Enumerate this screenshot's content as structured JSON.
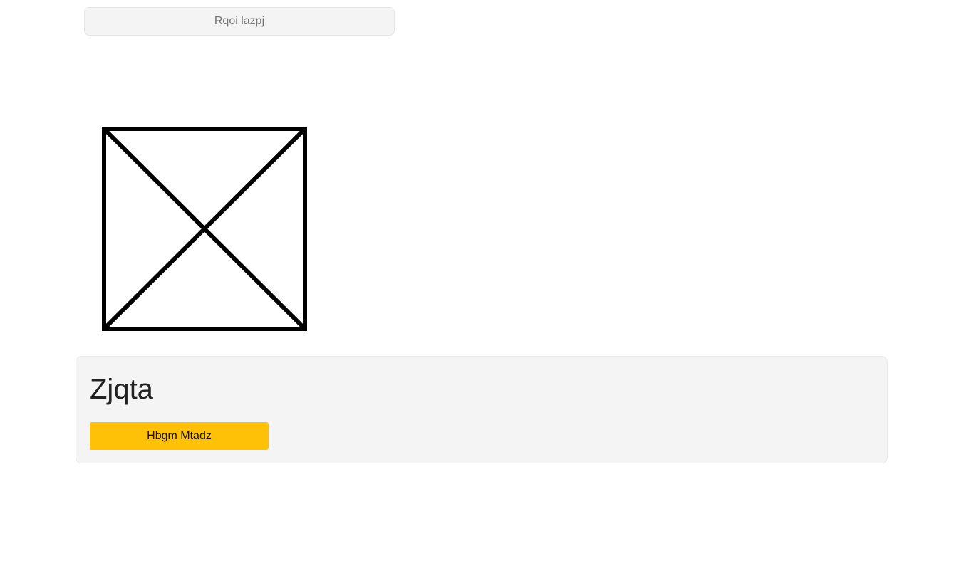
{
  "top_field": {
    "placeholder": "Rqoi lazpj"
  },
  "image": {
    "icon": "image-placeholder-icon",
    "stroke_color": "#000000"
  },
  "card": {
    "title": "Zjqta",
    "button_label": "Hbgm Mtadz",
    "button_color": "#ffc107",
    "background": "#f4f4f4"
  }
}
